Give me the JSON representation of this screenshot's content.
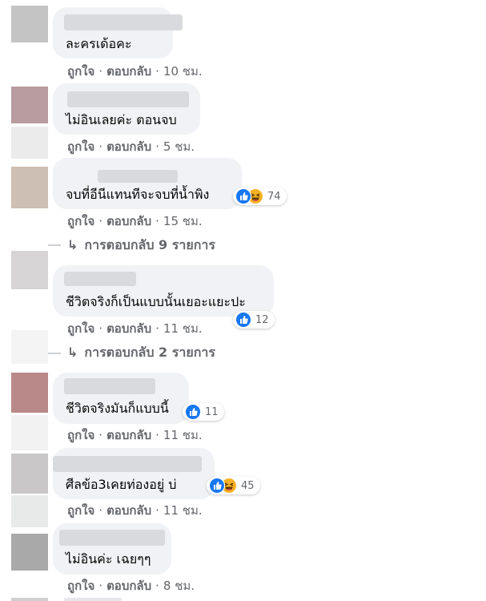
{
  "colors": {
    "bubble": "#f0f2f5",
    "meta_text": "#65676b",
    "like_blue": "#1877f2",
    "haha_yellow": "#f7b125"
  },
  "icons": {
    "reply_arrow": "↳",
    "like": "like-icon",
    "haha": "haha-icon"
  },
  "comments": [
    {
      "text": "ละครเด้อคะ",
      "like": "ถูกใจ",
      "reply": "ตอบกลับ",
      "time": "10 ชม."
    },
    {
      "text": "ไม่อินเลยค่ะ ตอนจบ",
      "like": "ถูกใจ",
      "reply": "ตอบกลับ",
      "time": "5 ชม."
    },
    {
      "text": "จบที่อีนีแทนทีจะจบที่น้ำพิง",
      "like": "ถูกใจ",
      "reply": "ตอบกลับ",
      "time": "15 ชม.",
      "reaction_count": "74",
      "view_replies": "การตอบกลับ 9 รายการ"
    },
    {
      "text": "ชีวิตจริงก็เป็นแบบนั้นเยอะแยะปะ",
      "like": "ถูกใจ",
      "reply": "ตอบกลับ",
      "time": "11 ชม.",
      "reaction_count": "12",
      "view_replies": "การตอบกลับ 2 รายการ"
    },
    {
      "text": "ชีวิตจริงมันก็แบบนี้",
      "like": "ถูกใจ",
      "reply": "ตอบกลับ",
      "time": "11 ชม.",
      "reaction_count": "11"
    },
    {
      "text": "ศีลข้อ3เคยท่องอยู่ บ่",
      "like": "ถูกใจ",
      "reply": "ตอบกลับ",
      "time": "11 ชม.",
      "reaction_count": "45"
    },
    {
      "text": "ไม่อินค่ะ เฉยๆๆ",
      "like": "ถูกใจ",
      "reply": "ตอบกลับ",
      "time": "8 ชม."
    }
  ]
}
